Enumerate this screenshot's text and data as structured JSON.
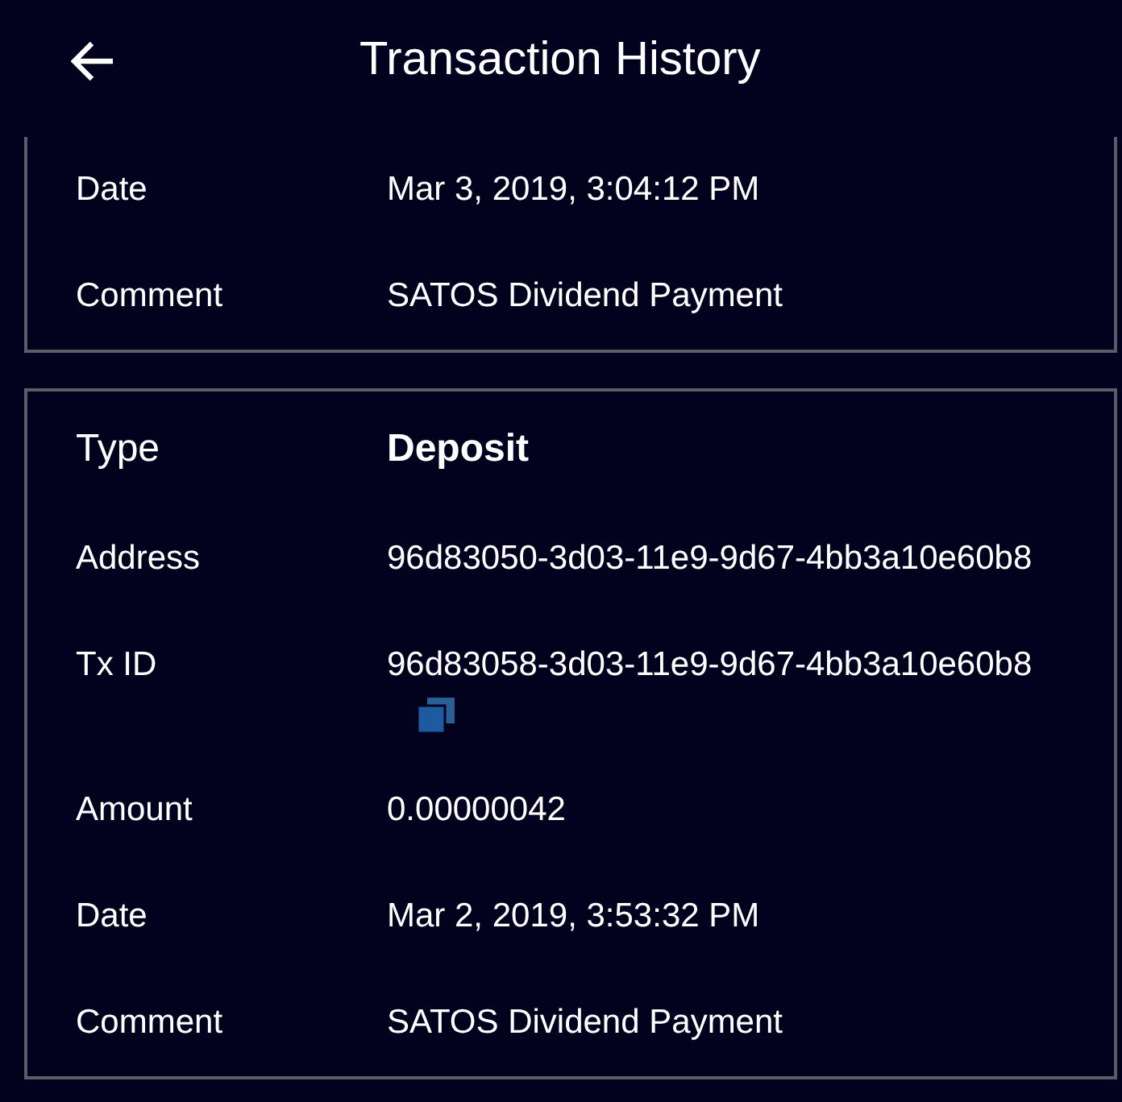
{
  "header": {
    "title": "Transaction History"
  },
  "cards": [
    {
      "cut_top": true,
      "rows": [
        {
          "kind": "plain",
          "label": "Date",
          "value": "Mar 3, 2019, 3:04:12 PM"
        },
        {
          "kind": "plain",
          "label": "Comment",
          "value": "SATOS Dividend Payment"
        }
      ]
    },
    {
      "cut_top": false,
      "rows": [
        {
          "kind": "heading",
          "label": "Type",
          "value": "Deposit"
        },
        {
          "kind": "plain",
          "label": "Address",
          "value": "96d83050-3d03-11e9-9d67-4bb3a10e60b8"
        },
        {
          "kind": "copy",
          "label": "Tx ID",
          "value": "96d83058-3d03-11e9-9d67-4bb3a10e60b8"
        },
        {
          "kind": "plain",
          "label": "Amount",
          "value": "0.00000042"
        },
        {
          "kind": "plain",
          "label": "Date",
          "value": "Mar 2, 2019, 3:53:32 PM"
        },
        {
          "kind": "plain",
          "label": "Comment",
          "value": "SATOS Dividend Payment"
        }
      ]
    }
  ]
}
